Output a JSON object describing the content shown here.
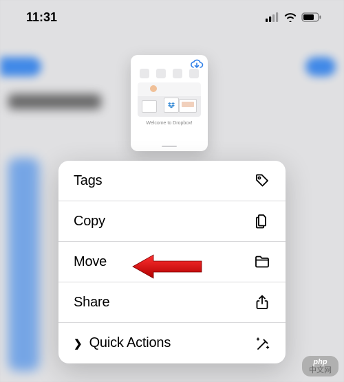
{
  "status": {
    "time": "11:31"
  },
  "preview": {
    "caption": "Welcome to Dropbox!"
  },
  "menu": {
    "items": [
      {
        "label": "Tags",
        "icon": "tag-icon"
      },
      {
        "label": "Copy",
        "icon": "copy-icon"
      },
      {
        "label": "Move",
        "icon": "folder-icon"
      },
      {
        "label": "Share",
        "icon": "share-icon"
      },
      {
        "label": "Quick Actions",
        "icon": "magic-icon"
      }
    ]
  },
  "watermark": {
    "line1": "php",
    "line2": "中文网"
  }
}
